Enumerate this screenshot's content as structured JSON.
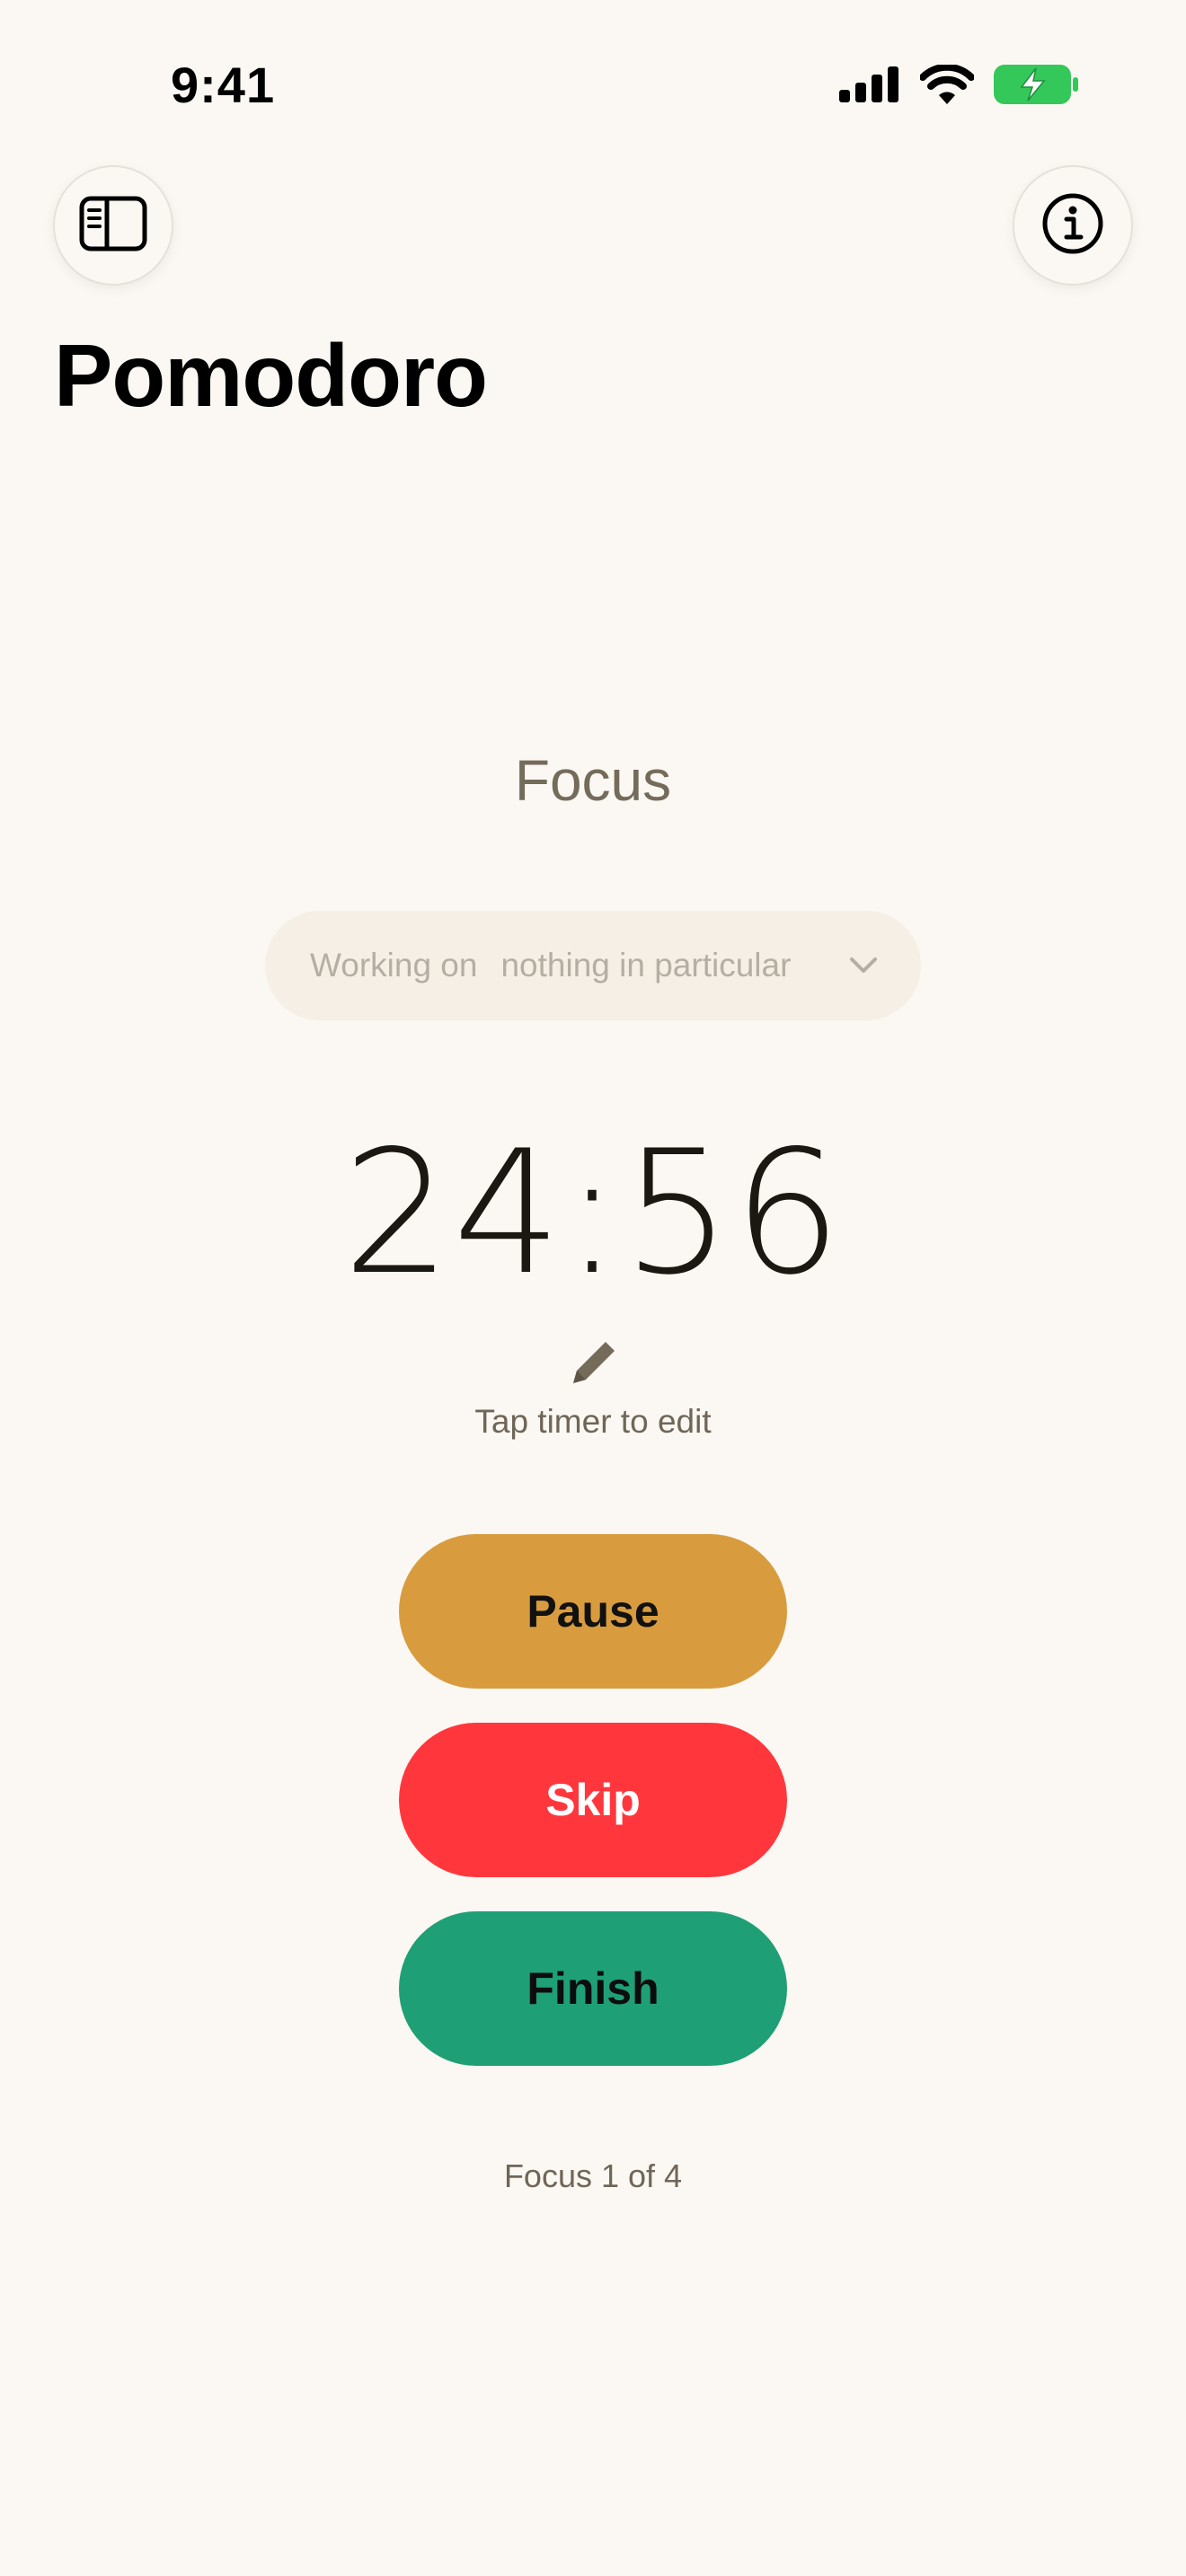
{
  "status_bar": {
    "time": "9:41",
    "icons": [
      "cellular-signal-icon",
      "wifi-icon",
      "battery-charging-icon"
    ],
    "battery_color": "#34C759"
  },
  "header": {
    "sidebar_button_icon": "sidebar-icon",
    "info_button_icon": "info-icon",
    "title": "Pomodoro"
  },
  "session": {
    "phase": "Focus",
    "task_picker": {
      "prefix": "Working on",
      "value": "nothing in particular",
      "icon": "chevron-down-icon"
    },
    "timer": "24:56",
    "edit_icon": "pencil-icon",
    "edit_hint": "Tap timer to edit",
    "progress_text": "Focus 1 of 4"
  },
  "actions": {
    "pause": {
      "label": "Pause",
      "color": "#D89C3E"
    },
    "skip": {
      "label": "Skip",
      "color": "#FF373D"
    },
    "finish": {
      "label": "Finish",
      "color": "#1F9F76"
    }
  },
  "colors": {
    "background": "#FBF8F3",
    "muted_text": "#756B5A",
    "pill_background": "#F5EFE5"
  }
}
